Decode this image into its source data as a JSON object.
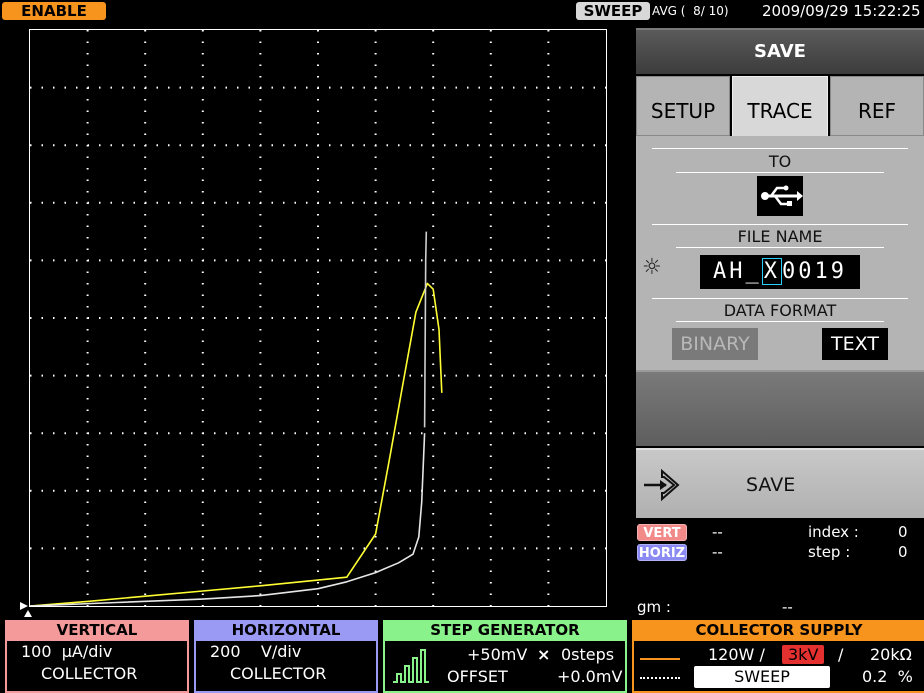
{
  "topbar": {
    "enable_label": "ENABLE",
    "sweep_label": "SWEEP",
    "avg_text": "AVG (  8/ 10)",
    "datetime": "2009/09/29 15:22:25"
  },
  "colors": {
    "accent_orange": "#f7941d",
    "trace_yellow": "#ffff33",
    "trace_white": "#e6e6e6",
    "vertical_pink": "#f49a9a",
    "horizontal_blue": "#9a9af4",
    "step_green": "#8af28a",
    "kv_red": "#e53030"
  },
  "panel": {
    "title": "SAVE",
    "tabs": [
      {
        "label": "SETUP",
        "active": false
      },
      {
        "label": "TRACE",
        "active": true
      },
      {
        "label": "REF",
        "active": false
      }
    ],
    "to_label": "TO",
    "to_icon": "usb-icon",
    "file_name_label": "FILE NAME",
    "file_name_prefix": "AH_",
    "file_name_cursor_char": "X",
    "file_name_suffix": "0019",
    "data_format_label": "DATA FORMAT",
    "format_options": [
      "BINARY",
      "TEXT"
    ],
    "format_selected": "TEXT",
    "save_action_label": "SAVE",
    "save_action_icon": "enter-icon"
  },
  "cursors": {
    "vert_label": "VERT",
    "vert_value": "--",
    "vert_index_label": "index :",
    "vert_index_value": "0",
    "horiz_label": "HORIZ",
    "horiz_value": "--",
    "horiz_step_label": "step :",
    "horiz_step_value": "0",
    "gm_label": "gm :",
    "gm_value": "--"
  },
  "bottom": {
    "vertical": {
      "title": "VERTICAL",
      "scale": "100  μA/div",
      "source": "COLLECTOR"
    },
    "horizontal": {
      "title": "HORIZONTAL",
      "scale": "200    V/div",
      "source": "COLLECTOR"
    },
    "step": {
      "title": "STEP GENERATOR",
      "amplitude": "+50mV",
      "times": "×",
      "steps": "0steps",
      "offset_label": "OFFSET",
      "offset_value": "+0.0mV"
    },
    "collector": {
      "title": "COLLECTOR SUPPLY",
      "power": "120W /",
      "voltage": "3kV",
      "slash": "/",
      "resistance": "20kΩ",
      "mode": "SWEEP",
      "percent": "0.2  %"
    }
  },
  "chart_data": {
    "type": "line",
    "title": "",
    "xlabel": "",
    "ylabel": "",
    "grid": true,
    "divisions": {
      "x": 10,
      "y": 10
    },
    "x_unit": "V",
    "y_unit": "μA",
    "xlim": [
      0,
      2000
    ],
    "ylim": [
      0,
      1000
    ],
    "series": [
      {
        "color": "#ffff33",
        "x": [
          0,
          200,
          400,
          600,
          800,
          1100,
          1200,
          1250,
          1300,
          1340,
          1380,
          1400,
          1420,
          1430
        ],
        "y": [
          0,
          8,
          17,
          26,
          35,
          50,
          125,
          260,
          400,
          510,
          560,
          550,
          480,
          370
        ]
      },
      {
        "color": "#e6e6e6",
        "x": [
          0,
          300,
          600,
          800,
          1000,
          1100,
          1200,
          1280,
          1330,
          1350,
          1360,
          1370
        ],
        "y": [
          0,
          6,
          12,
          18,
          30,
          42,
          58,
          75,
          90,
          120,
          180,
          300
        ]
      },
      {
        "color": "#cfcfcf",
        "x": [
          1370,
          1372,
          1374,
          1376
        ],
        "y": [
          310,
          440,
          600,
          650
        ]
      }
    ]
  }
}
